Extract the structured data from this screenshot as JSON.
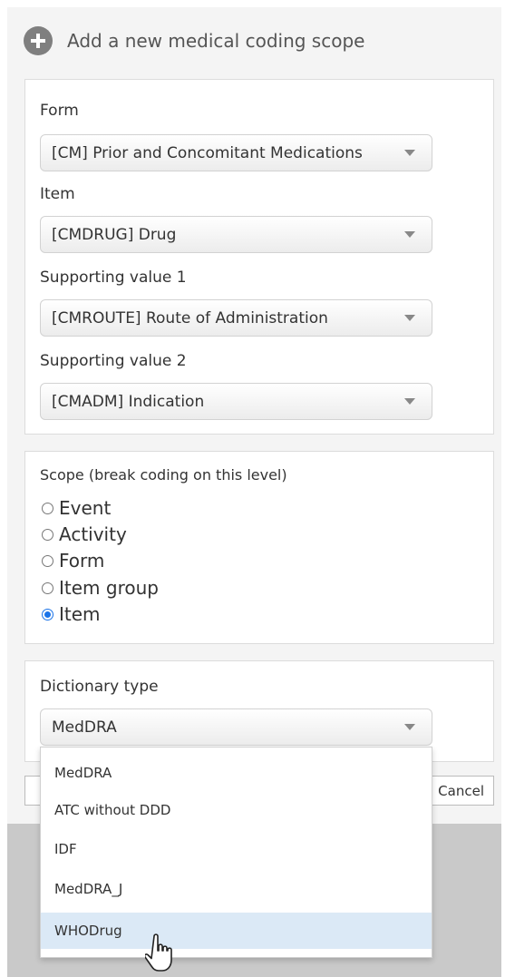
{
  "header": {
    "title": "Add a new medical coding scope",
    "icon": "plus-circle-icon"
  },
  "form_section": {
    "form": {
      "label": "Form",
      "value": "[CM] Prior and Concomitant Medications"
    },
    "item": {
      "label": "Item",
      "value": "[CMDRUG] Drug"
    },
    "supporting1": {
      "label": "Supporting value 1",
      "value": "[CMROUTE] Route of Administration"
    },
    "supporting2": {
      "label": "Supporting value 2",
      "value": "[CMADM] Indication"
    }
  },
  "scope": {
    "title": "Scope (break coding on this level)",
    "options": [
      {
        "label": "Event",
        "checked": false
      },
      {
        "label": "Activity",
        "checked": false
      },
      {
        "label": "Form",
        "checked": false
      },
      {
        "label": "Item group",
        "checked": false
      },
      {
        "label": "Item",
        "checked": true
      }
    ]
  },
  "dictionary": {
    "label": "Dictionary type",
    "value": "MedDRA",
    "options": [
      {
        "label": "MedDRA",
        "highlighted": false
      },
      {
        "label": "ATC without DDD",
        "highlighted": false
      },
      {
        "label": "IDF",
        "highlighted": false
      },
      {
        "label": "MedDRA_J",
        "highlighted": false
      },
      {
        "label": "WHODrug",
        "highlighted": true
      }
    ]
  },
  "footer": {
    "cancel_label": "Cancel"
  },
  "colors": {
    "accent": "#1a73e8",
    "hover": "#dbe9f6"
  }
}
